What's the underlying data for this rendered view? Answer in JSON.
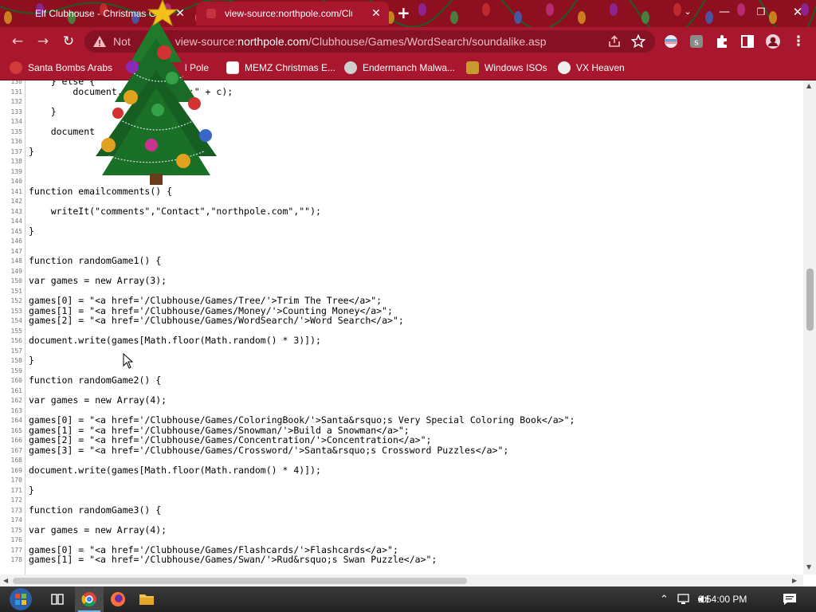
{
  "tabs": [
    {
      "label": "Elf Clubhouse - Christmas G",
      "active": false
    },
    {
      "label": "view-source:northpole.com/Club",
      "active": true
    }
  ],
  "omnibox": {
    "security_label": "Not",
    "url_prefix": "view-source:",
    "url_domain": "northpole.com",
    "url_path": "/Clubhouse/Games/WordSearch/soundalike.asp"
  },
  "bookmarks": [
    {
      "label": "Santa Bombs Arabs"
    },
    {
      "label": "l Pole"
    },
    {
      "label": "MEMZ Christmas E..."
    },
    {
      "label": "Endermanch Malwa..."
    },
    {
      "label": "Windows ISOs"
    },
    {
      "label": "VX Heaven"
    }
  ],
  "code_lines": [
    {
      "n": "130",
      "text": "    } else {"
    },
    {
      "n": "131",
      "text": "        document.write(\"&nbsp;\" + c);"
    },
    {
      "n": "132",
      "text": ""
    },
    {
      "n": "133",
      "text": "    }"
    },
    {
      "n": "134",
      "text": ""
    },
    {
      "n": "135",
      "text": "    document"
    },
    {
      "n": "136",
      "text": ""
    },
    {
      "n": "137",
      "text": "}"
    },
    {
      "n": "138",
      "text": ""
    },
    {
      "n": "139",
      "text": ""
    },
    {
      "n": "140",
      "text": ""
    },
    {
      "n": "141",
      "text": "function emailcomments() {"
    },
    {
      "n": "142",
      "text": ""
    },
    {
      "n": "143",
      "text": "    writeIt(\"comments\",\"Contact\",\"northpole.com\",\"\");"
    },
    {
      "n": "144",
      "text": ""
    },
    {
      "n": "145",
      "text": "}"
    },
    {
      "n": "146",
      "text": ""
    },
    {
      "n": "147",
      "text": ""
    },
    {
      "n": "148",
      "text": "function randomGame1() {"
    },
    {
      "n": "149",
      "text": ""
    },
    {
      "n": "150",
      "text": "var games = new Array(3);"
    },
    {
      "n": "151",
      "text": ""
    },
    {
      "n": "152",
      "text": "games[0] = \"<a href='/Clubhouse/Games/Tree/'>Trim The Tree</a>\";"
    },
    {
      "n": "153",
      "text": "games[1] = \"<a href='/Clubhouse/Games/Money/'>Counting Money</a>\";"
    },
    {
      "n": "154",
      "text": "games[2] = \"<a href='/Clubhouse/Games/WordSearch/'>Word Search</a>\";"
    },
    {
      "n": "155",
      "text": ""
    },
    {
      "n": "156",
      "text": "document.write(games[Math.floor(Math.random() * 3)]);"
    },
    {
      "n": "157",
      "text": ""
    },
    {
      "n": "158",
      "text": "}"
    },
    {
      "n": "159",
      "text": ""
    },
    {
      "n": "160",
      "text": "function randomGame2() {"
    },
    {
      "n": "161",
      "text": ""
    },
    {
      "n": "162",
      "text": "var games = new Array(4);"
    },
    {
      "n": "163",
      "text": ""
    },
    {
      "n": "164",
      "text": "games[0] = \"<a href='/Clubhouse/Games/ColoringBook/'>Santa&rsquo;s Very Special Coloring Book</a>\";"
    },
    {
      "n": "165",
      "text": "games[1] = \"<a href='/Clubhouse/Games/Snowman/'>Build a Snowman</a>\";"
    },
    {
      "n": "166",
      "text": "games[2] = \"<a href='/Clubhouse/Games/Concentration/'>Concentration</a>\";"
    },
    {
      "n": "167",
      "text": "games[3] = \"<a href='/Clubhouse/Games/Crossword/'>Santa&rsquo;s Crossword Puzzles</a>\";"
    },
    {
      "n": "168",
      "text": ""
    },
    {
      "n": "169",
      "text": "document.write(games[Math.floor(Math.random() * 4)]);"
    },
    {
      "n": "170",
      "text": ""
    },
    {
      "n": "171",
      "text": "}"
    },
    {
      "n": "172",
      "text": ""
    },
    {
      "n": "173",
      "text": "function randomGame3() {"
    },
    {
      "n": "174",
      "text": ""
    },
    {
      "n": "175",
      "text": "var games = new Array(4);"
    },
    {
      "n": "176",
      "text": ""
    },
    {
      "n": "177",
      "text": "games[0] = \"<a href='/Clubhouse/Games/Flashcards/'>Flashcards</a>\";"
    },
    {
      "n": "178",
      "text": "games[1] = \"<a href='/Clubhouse/Games/Swan/'>Rud&rsquo;s Swan Puzzle</a>\";"
    }
  ],
  "taskbar": {
    "clock": "2:54:00 PM"
  },
  "colors": {
    "titlebar": "#8e1020",
    "toolbar": "#a8172d",
    "omnibox": "#861024"
  }
}
